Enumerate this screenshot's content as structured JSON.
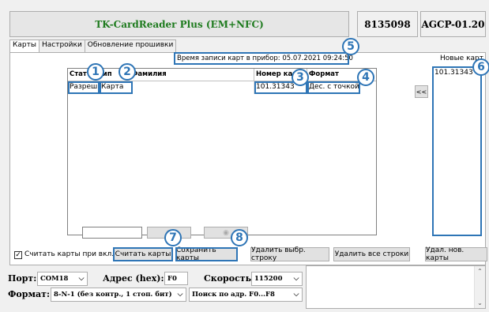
{
  "header": {
    "title": "TK-CardReader Plus (EM+NFC)",
    "serial": "8135098",
    "device": "AGCP-01.20"
  },
  "tabs": [
    {
      "label": "Карты"
    },
    {
      "label": "Настройки"
    },
    {
      "label": "Обновление прошивки"
    }
  ],
  "write_time": {
    "label": "Время записи карт в прибор:",
    "value": "05.07.2021  09:24:50"
  },
  "grid": {
    "columns": [
      "Стат",
      "Тип",
      "Фамилия",
      "Номер карт",
      "Формат"
    ],
    "rows": [
      {
        "status": "Разреш.",
        "type": "Карта",
        "name": "",
        "number": "101.31343",
        "format": "Дес. с точкой"
      }
    ]
  },
  "new_cards": {
    "label": "Новые карт",
    "items": [
      "101.31343"
    ],
    "transfer_button": "<<"
  },
  "badges": [
    "1",
    "2",
    "3",
    "4",
    "5",
    "6",
    "7",
    "8"
  ],
  "actions": {
    "read_on_start": "Считать карты при вкл.",
    "read_on_start_checked": true,
    "read_cards": "Считать карты",
    "save_cards": "Сохранить карты",
    "delete_selected": "Удалить выбр. строку",
    "delete_all": "Удалить все строки",
    "delete_new": "Удал. нов. карты"
  },
  "connection": {
    "port_label": "Порт:",
    "port_value": "COM18",
    "address_label": "Адрес (hex):",
    "address_value": "F0",
    "speed_label": "Скорость:",
    "speed_value": "115200",
    "format_label": "Формат:",
    "format_value": "8-N-1 (без контр., 1 стоп. бит)",
    "search_value": "Поиск по адр. F0...F8"
  },
  "colors": {
    "title_green": "#1e7b1e",
    "annotation_blue": "#2e75b6"
  }
}
